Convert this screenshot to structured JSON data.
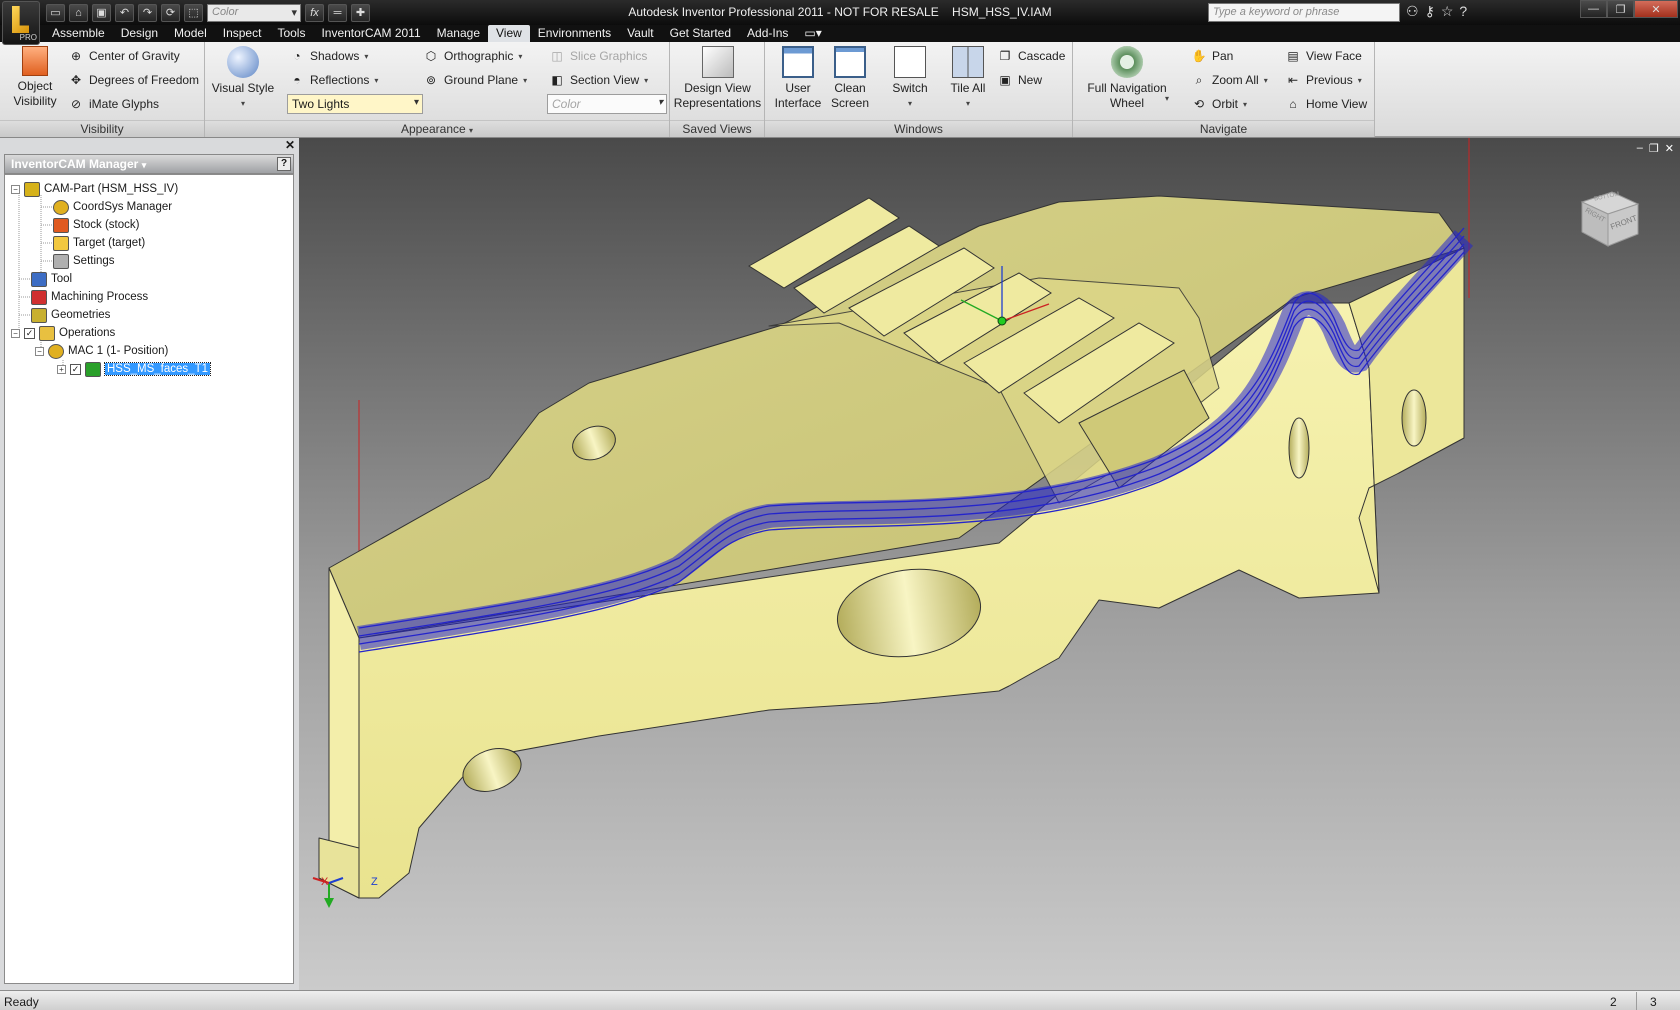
{
  "title": "Autodesk Inventor Professional 2011 - NOT FOR RESALE    HSM_HSS_IV.IAM",
  "app_badge": "PRO",
  "quick_access": {
    "color_combo": "Color",
    "fx_label": "fx"
  },
  "search": {
    "placeholder": "Type a keyword or phrase"
  },
  "tabs": [
    "Assemble",
    "Design",
    "Model",
    "Inspect",
    "Tools",
    "InventorCAM 2011",
    "Manage",
    "View",
    "Environments",
    "Vault",
    "Get Started",
    "Add-Ins"
  ],
  "active_tab": "View",
  "ribbon": {
    "visibility": {
      "object_visibility": "Object\nVisibility",
      "center_of_gravity": "Center of Gravity",
      "degrees_of_freedom": "Degrees of Freedom",
      "imate_glyphs": "iMate Glyphs",
      "label": "Visibility"
    },
    "appearance": {
      "visual_style": "Visual Style",
      "shadows": "Shadows",
      "reflections": "Reflections",
      "lighting": "Two Lights",
      "orthographic": "Orthographic",
      "ground_plane": "Ground Plane",
      "slice_graphics": "Slice Graphics",
      "section_view": "Section View",
      "color_combo": "Color",
      "label": "Appearance"
    },
    "saved_views": {
      "design_view": "Design View\nRepresentations",
      "label": "Saved Views"
    },
    "windows": {
      "user_interface": "User\nInterface",
      "clean_screen": "Clean\nScreen",
      "switch": "Switch",
      "tile_all": "Tile All",
      "cascade": "Cascade",
      "new": "New",
      "label": "Windows"
    },
    "navigate": {
      "full_nav_wheel": "Full Navigation\nWheel",
      "pan": "Pan",
      "zoom_all": "Zoom All",
      "orbit": "Orbit",
      "view_face": "View Face",
      "previous": "Previous",
      "home_view": "Home View",
      "label": "Navigate"
    }
  },
  "browser": {
    "title": "InventorCAM Manager",
    "tree": [
      {
        "label": "CAM-Part (HSM_HSS_IV)"
      },
      {
        "label": "CoordSys Manager"
      },
      {
        "label": "Stock (stock)"
      },
      {
        "label": "Target (target)"
      },
      {
        "label": "Settings"
      },
      {
        "label": "Tool"
      },
      {
        "label": "Machining Process"
      },
      {
        "label": "Geometries"
      },
      {
        "label": "Operations"
      },
      {
        "label": "MAC 1 (1- Position)"
      },
      {
        "label": "HSS_MS_faces_T1"
      }
    ]
  },
  "viewcube": {
    "front": "FRONT",
    "right": "RIGHT",
    "top": "BOTTOM"
  },
  "triad": {
    "x": "X",
    "z": "Z"
  },
  "colors": {
    "part": "#ecec9c",
    "toolpath": "#2424cc",
    "selection": "#3399ff"
  },
  "status": {
    "text": "Ready",
    "n1": "2",
    "n2": "3"
  }
}
